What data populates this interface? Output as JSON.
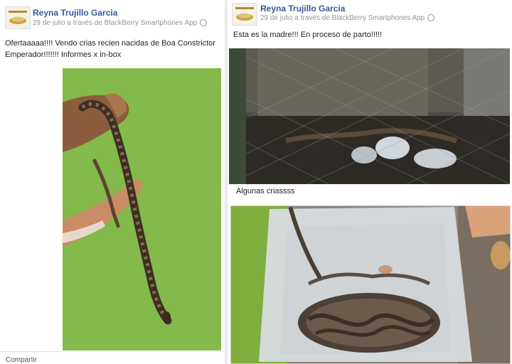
{
  "posts": [
    {
      "author": "Reyna Trujillo Garcia",
      "meta": "29 de julio a través de BlackBerry Smartphones App",
      "text": "Ofertaaaaa!!!! Vendo crias recien nacidas de Boa Constrictor Emperador!!!!!!! Informes x in-box",
      "share": "Compartir"
    },
    {
      "author": "Reyna Trujillo Garcia",
      "meta": "29 de julio a través de BlackBerry Smartphones App",
      "text": "Esta es la madre!!! En proceso de parto!!!!!",
      "caption": "Algunas criassss"
    }
  ],
  "icons": [
    "public-globe-icon"
  ]
}
